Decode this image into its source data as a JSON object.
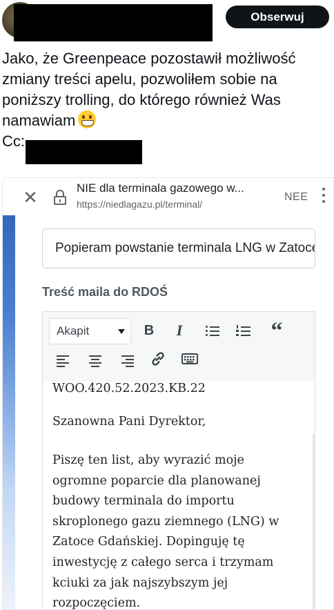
{
  "tweet": {
    "follow_label": "Obserwuj",
    "lines": [
      "Jako, że Greenpeace pozostawił możliwość",
      "zmiany treści apelu, pozwoliłem sobie na",
      "poniższy trolling, do którego również Was",
      "namawiam"
    ],
    "cc_label": "Cc:"
  },
  "browser": {
    "page_title": "NIE dla terminala gazowego w...",
    "url": "https://niedlagazu.pl/terminal/",
    "badge": "NEE"
  },
  "form": {
    "subject_value": "Popieram powstanie terminala LNG w Zatoce",
    "section_heading": "Treść maila do RDOŚ",
    "format_select": "Akapit",
    "editor": {
      "reference": "WOO.420.52.2023.KB.22",
      "greeting": "Szanowna Pani Dyrektor,",
      "body_lines": [
        "Piszę ten list, aby wyrazić moje",
        "ogromne poparcie dla planowanej",
        "budowy terminala do importu",
        "skroplonego gazu ziemnego (LNG) w",
        "Zatoce Gdańskiej. Dopinguję tę",
        "inwestycję z całego serca i trzymam",
        "kciuki za jak najszybszym jej",
        "rozpoczęciem."
      ]
    }
  },
  "colors": {
    "follow_bg": "#0f1419",
    "accent_strip": "#3568b8",
    "toolbar_bg": "#f6f7f7"
  }
}
